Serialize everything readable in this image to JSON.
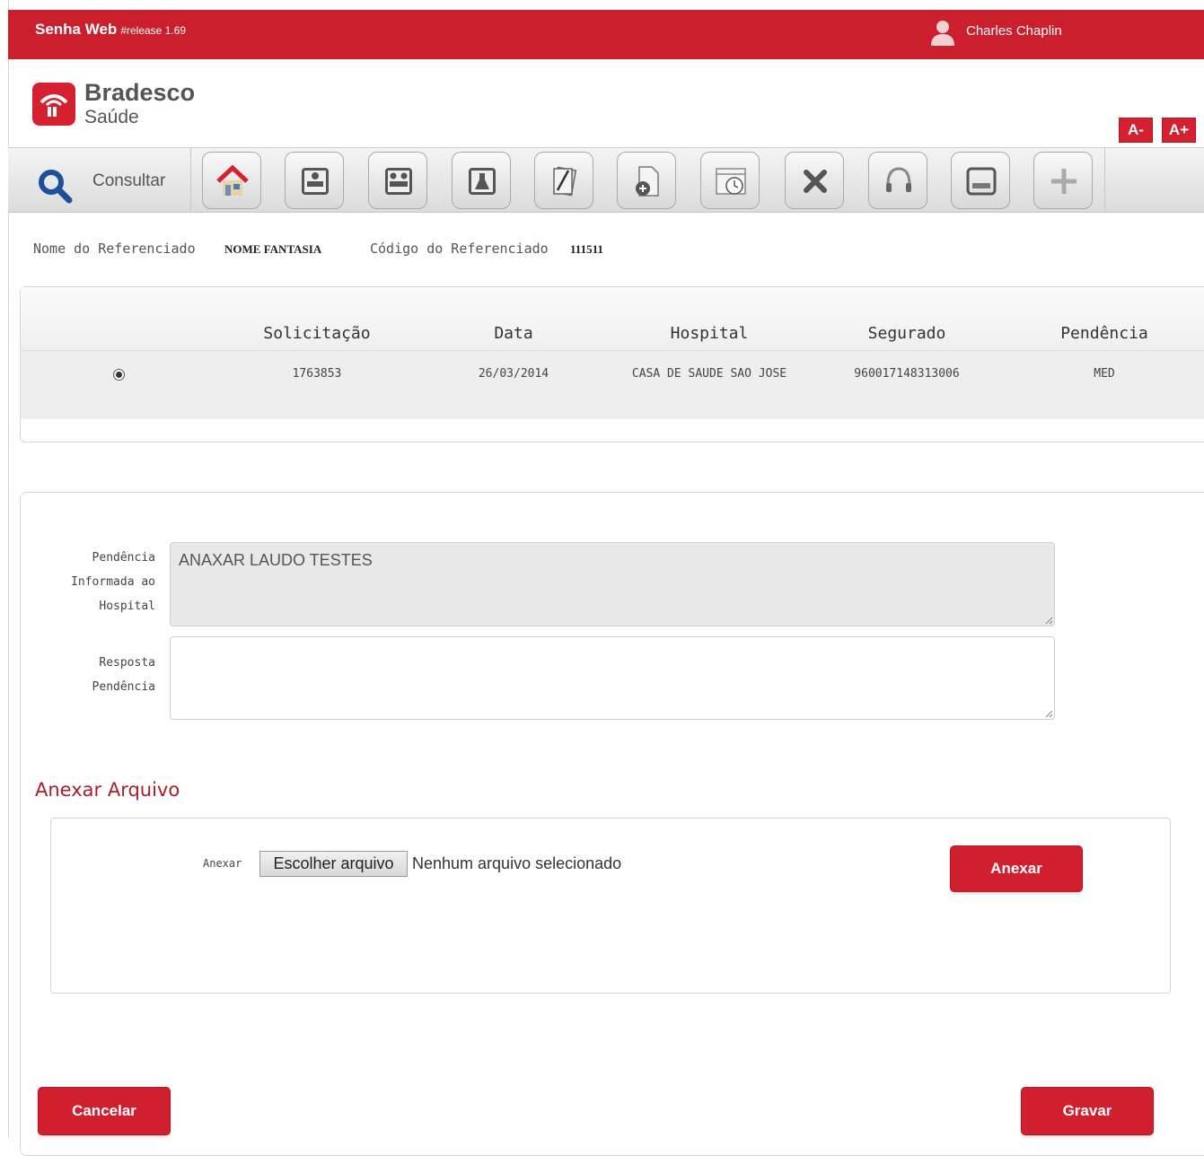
{
  "header": {
    "app_name": "Senha Web",
    "release": "#release 1.69",
    "user_name": "Charles Chaplin",
    "brand_color": "#cc1f2e"
  },
  "logo": {
    "brand": "Bradesco",
    "sub": "Saúde"
  },
  "font_controls": {
    "decrease": "A-",
    "increase": "A+"
  },
  "toolbar": {
    "search_label": "Consultar",
    "icons": [
      "home-icon",
      "hospital-bed-icon",
      "patients-icon",
      "lab-flask-icon",
      "documents-icon",
      "add-document-icon",
      "calendar-clock-icon",
      "cancel-icon",
      "headset-icon",
      "tray-icon",
      "plus-icon"
    ]
  },
  "referenciado": {
    "name_label": "Nome do Referenciado",
    "name_value": "NOME FANTASIA",
    "code_label": "Código do Referenciado",
    "code_value": "111511"
  },
  "table": {
    "columns": [
      "Solicitação",
      "Data",
      "Hospital",
      "Segurado",
      "Pendência"
    ],
    "rows": [
      {
        "selected": true,
        "solicitacao": "1763853",
        "data": "26/03/2014",
        "hospital": "CASA DE SAUDE SAO JOSE",
        "segurado": "960017148313006",
        "pendencia": "MED"
      }
    ]
  },
  "form": {
    "pendencia_label": "Pendência Informada ao Hospital",
    "pendencia_value": "ANAXAR LAUDO TESTES",
    "resposta_label": "Resposta Pendência",
    "resposta_value": ""
  },
  "attach": {
    "title": "Anexar Arquivo",
    "label": "Anexar",
    "choose_button": "Escolher arquivo",
    "file_status": "Nenhum arquivo selecionado",
    "attach_button": "Anexar"
  },
  "actions": {
    "cancel": "Cancelar",
    "save": "Gravar"
  }
}
